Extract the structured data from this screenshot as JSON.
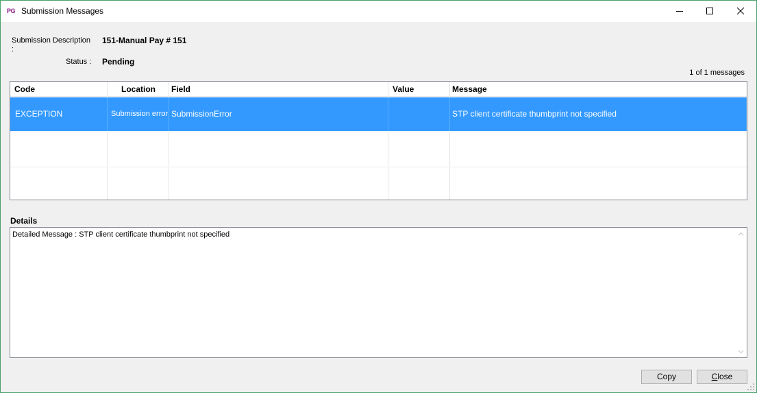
{
  "window": {
    "app_logo": "PG",
    "title": "Submission Messages"
  },
  "form": {
    "description_label": "Submission Description :",
    "description_value": "151-Manual Pay # 151",
    "status_label": "Status :",
    "status_value": "Pending",
    "message_count": "1 of 1 messages"
  },
  "grid": {
    "columns": [
      "Code",
      "Location",
      "Field",
      "Value",
      "Message"
    ],
    "rows": [
      {
        "code": "EXCEPTION",
        "location": "Submission error",
        "field": "SubmissionError",
        "value": "",
        "message": "STP client certificate thumbprint not specified"
      }
    ]
  },
  "details": {
    "label": "Details",
    "text": "Detailed Message : STP client certificate thumbprint not specified"
  },
  "buttons": {
    "copy": "Copy",
    "close_underline": "C",
    "close_rest": "lose"
  },
  "colors": {
    "selection": "#3399ff",
    "window_border": "#4aa06a",
    "logo": "#8e1f8e"
  }
}
